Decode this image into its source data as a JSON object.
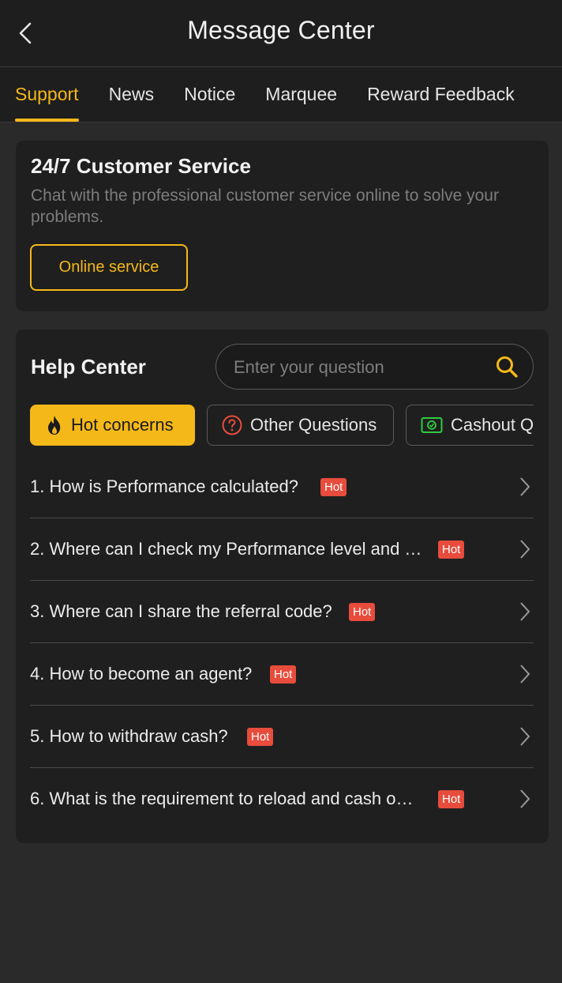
{
  "header": {
    "title": "Message Center"
  },
  "tabs": [
    {
      "label": "Support"
    },
    {
      "label": "News"
    },
    {
      "label": "Notice"
    },
    {
      "label": "Marquee"
    },
    {
      "label": "Reward Feedback"
    }
  ],
  "customer_service": {
    "title": "24/7 Customer Service",
    "description": "Chat with the professional customer service online to solve your problems.",
    "button_label": "Online service"
  },
  "help_center": {
    "title": "Help Center",
    "search_placeholder": "Enter your question",
    "categories": [
      {
        "label": "Hot concerns",
        "icon": "fire-icon"
      },
      {
        "label": "Other Questions",
        "icon": "question-circle-icon"
      },
      {
        "label": "Cashout Q",
        "icon": "cash-icon"
      }
    ],
    "questions": [
      {
        "text": "1. How is Performance calculated?",
        "badge": "Hot"
      },
      {
        "text": "2. Where can I check my Performance level and …",
        "badge": "Hot"
      },
      {
        "text": "3. Where can I share the referral code?",
        "badge": "Hot"
      },
      {
        "text": "4. How to become an agent?",
        "badge": "Hot"
      },
      {
        "text": "5. How to withdraw cash?",
        "badge": "Hot"
      },
      {
        "text": "6. What is the requirement to reload and cash o…",
        "badge": "Hot"
      }
    ]
  },
  "colors": {
    "accent": "#f5b819",
    "hot_badge": "#e74c3c",
    "background": "#2a2a2a",
    "card": "#1f1f1f"
  }
}
